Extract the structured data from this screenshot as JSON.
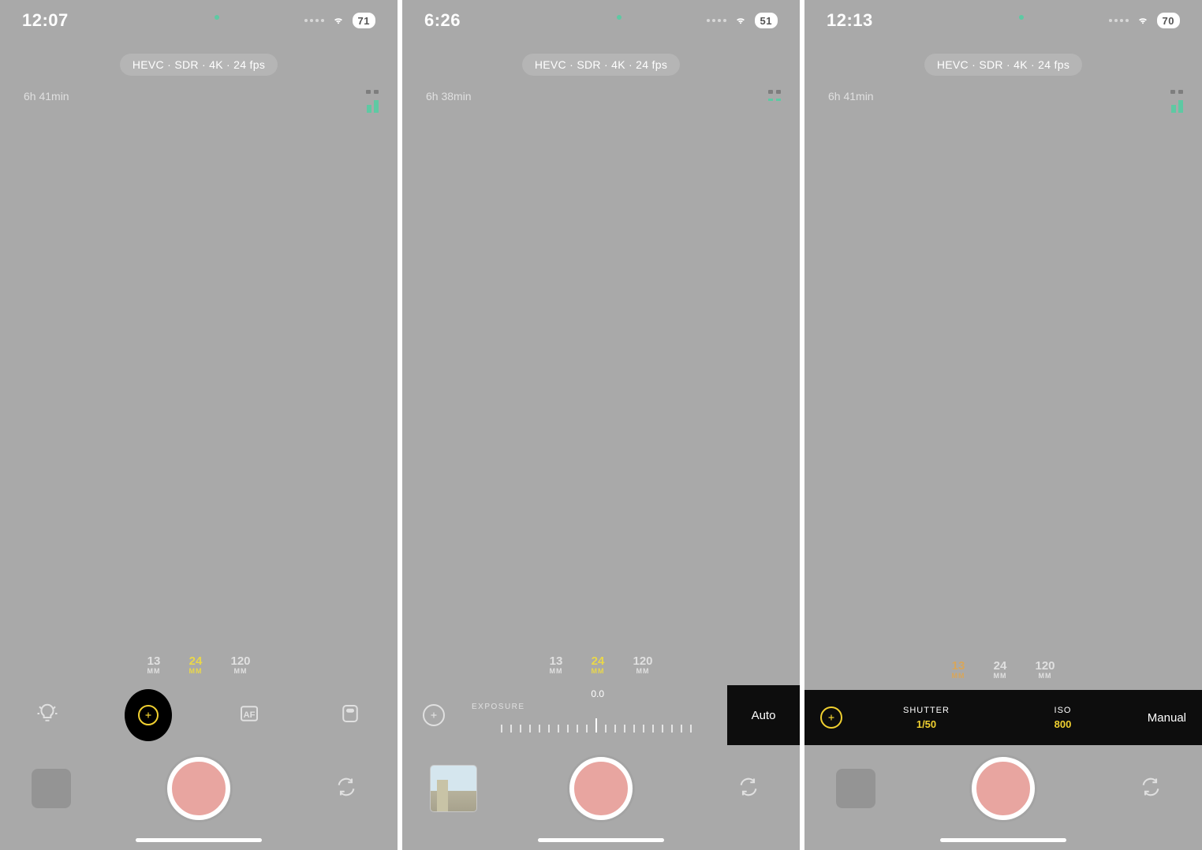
{
  "screens": [
    {
      "status": {
        "time": "12:07",
        "indicator": "bell-slash",
        "battery": "71"
      },
      "top": {
        "format": "HEVC · SDR · 4K · 24 fps"
      },
      "info": {
        "storage": "6h 41min",
        "audio_style": "bars"
      },
      "lenses": {
        "options": [
          {
            "num": "13",
            "unit": "MM"
          },
          {
            "num": "24",
            "unit": "MM"
          },
          {
            "num": "120",
            "unit": "MM"
          }
        ],
        "active_index": 1
      },
      "ctrl": {
        "mode": "collapsed"
      },
      "thumb": "empty"
    },
    {
      "status": {
        "time": "6:26",
        "indicator": "location",
        "battery": "51"
      },
      "top": {
        "format": "HEVC · SDR · 4K · 24 fps"
      },
      "info": {
        "storage": "6h 38min",
        "audio_style": "dashes"
      },
      "lenses": {
        "options": [
          {
            "num": "13",
            "unit": "MM"
          },
          {
            "num": "24",
            "unit": "MM"
          },
          {
            "num": "120",
            "unit": "MM"
          }
        ],
        "active_index": 1
      },
      "ctrl": {
        "mode": "auto-exposure",
        "label": "EXPOSURE",
        "value": "0.0",
        "mode_label": "Auto"
      },
      "thumb": "photo"
    },
    {
      "status": {
        "time": "12:13",
        "indicator": "bell-slash",
        "battery": "70"
      },
      "top": {
        "format": "HEVC · SDR · 4K · 24 fps"
      },
      "info": {
        "storage": "6h 41min",
        "audio_style": "bars"
      },
      "lenses": {
        "options": [
          {
            "num": "13",
            "unit": "MM"
          },
          {
            "num": "24",
            "unit": "MM"
          },
          {
            "num": "120",
            "unit": "MM"
          }
        ],
        "active_index": 0,
        "active_variant": "warm"
      },
      "ctrl": {
        "mode": "manual",
        "shutter_label": "SHUTTER",
        "shutter_value": "1/50",
        "iso_label": "ISO",
        "iso_value": "800",
        "mode_label": "Manual"
      },
      "thumb": "empty"
    }
  ]
}
